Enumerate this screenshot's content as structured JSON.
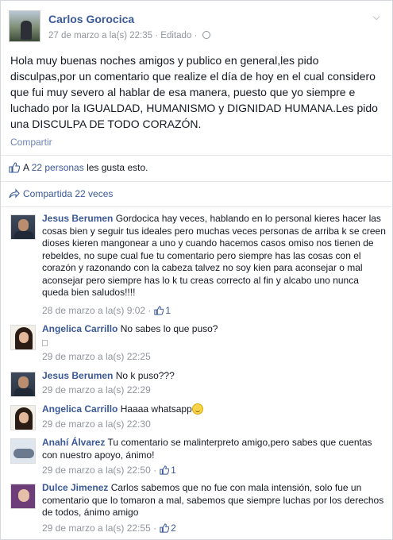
{
  "post": {
    "author": "Carlos Gorocica",
    "timestamp": "27 de marzo a la(s) 22:35",
    "edited": "· Editado ·",
    "text": "Hola muy buenas noches amigos y publico en general,les pido disculpas,por un comentario que realize el día de hoy en el cual considero que fui muy severo al hablar de esa manera, puesto que yo siempre e luchado por la IGUALDAD, HUMANISMO y DIGNIDAD HUMANA.Les pido una DISCULPA DE TODO CORAZÓN.",
    "share_label": "Compartir"
  },
  "likes": {
    "prefix": "A",
    "people": "22 personas",
    "suffix": "les gusta esto."
  },
  "shares": {
    "label": "Compartida 22 veces"
  },
  "comments": [
    {
      "name": "Jesus Berumen",
      "text": "Gordocica hay veces, hablando en lo personal kieres hacer las cosas bien y seguir tus ideales pero muchas veces personas de arriba k se creen dioses kieren mangonear a uno y cuando hacemos casos omiso nos tienen de rebeldes, no supe cual fue tu comentario pero siempre has las cosas con el corazón y razonando con la cabeza talvez no soy kien para aconsejar o mal aconsejar pero siempre has lo k tu creas correcto al fin y alcabo uno nunca queda bien saludos!!!!",
      "time": "28 de marzo a la(s) 9:02 ·",
      "likes": "1"
    },
    {
      "name": "Angelica Carrillo",
      "text": "No sabes lo que puso?",
      "time": "29 de marzo a la(s) 22:25",
      "likes": ""
    },
    {
      "name": "Jesus Berumen",
      "text": "No k puso???",
      "time": "29 de marzo a la(s) 22:29",
      "likes": ""
    },
    {
      "name": "Angelica Carrillo",
      "text": "Haaaa whatsapp",
      "time": "29 de marzo a la(s) 22:30",
      "likes": ""
    },
    {
      "name": "Anahí Álvarez",
      "text": "Tu comentario se malinterpreto amigo,pero sabes que cuentas con nuestro apoyo, ánimo!",
      "time": "29 de marzo a la(s) 22:50 ·",
      "likes": "1"
    },
    {
      "name": "Dulce Jimenez",
      "text": "Carlos sabemos que no fue con mala intensión, solo fue un comentario que lo tomaron a mal, sabemos que siempre luchas por los derechos de todos, ánimo amigo",
      "time": "29 de marzo a la(s) 22:55 ·",
      "likes": "2"
    }
  ],
  "icons": {
    "globe": "globe-icon",
    "chevron": "chevron-down-icon",
    "like": "thumbs-up-icon",
    "share": "share-arrow-icon",
    "smiley": "smiley-emoticon"
  },
  "colors": {
    "link": "#3b5998",
    "muted": "#90949c",
    "text": "#141823"
  }
}
